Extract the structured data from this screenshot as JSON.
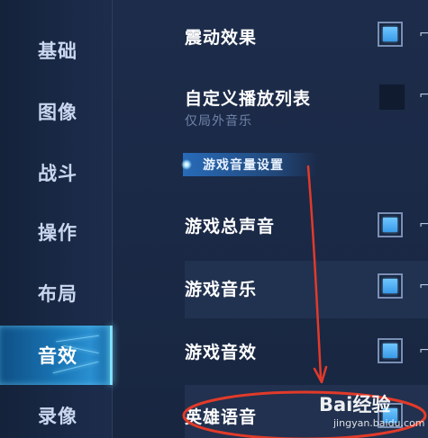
{
  "sidebar": {
    "items": [
      {
        "label": "基础"
      },
      {
        "label": "图像"
      },
      {
        "label": "战斗"
      },
      {
        "label": "操作"
      },
      {
        "label": "布局"
      },
      {
        "label": "音效",
        "active": true
      },
      {
        "label": "录像"
      }
    ]
  },
  "settings": {
    "vibration": {
      "label": "震动效果",
      "checked": true
    },
    "custom_playlist": {
      "label": "自定义播放列表",
      "sublabel": "仅局外音乐",
      "checked": false
    },
    "section_title": "游戏音量设置",
    "master_sound": {
      "label": "游戏总声音",
      "checked": true
    },
    "game_music": {
      "label": "游戏音乐",
      "checked": true
    },
    "game_sfx": {
      "label": "游戏音效",
      "checked": true
    },
    "hero_voice": {
      "label": "英雄语音",
      "checked": true
    }
  },
  "watermark": {
    "brand": "Bai经验",
    "url": "jingyan.baidu.com"
  },
  "colors": {
    "background": "#1b2a45",
    "active_tab": "#1a78b8",
    "checkbox_fill": "#4aa8f0",
    "annotation": "#e23a2a"
  }
}
